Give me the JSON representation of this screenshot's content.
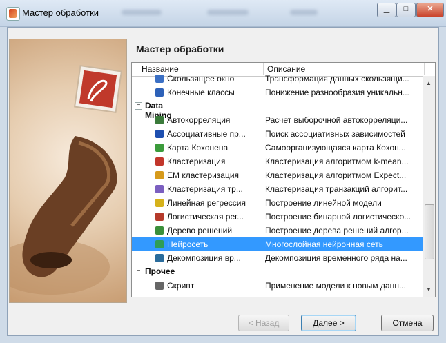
{
  "window": {
    "title": "Мастер обработки"
  },
  "wizard": {
    "heading": "Мастер обработки"
  },
  "list": {
    "columns": [
      "Название",
      "Описание"
    ],
    "rows": [
      {
        "kind": "item",
        "name": "Скользящее окно",
        "desc": "Трансформация данных скользящи...",
        "icon": "window-icon",
        "color": "#3a6fc4"
      },
      {
        "kind": "item",
        "name": "Конечные классы",
        "desc": "Понижение разнообразия уникальн...",
        "icon": "classes-icon",
        "color": "#2d61b8"
      },
      {
        "kind": "category",
        "name": "Data Mining",
        "toggle": "−"
      },
      {
        "kind": "item",
        "name": "Автокорреляция",
        "desc": "Расчет выборочной автокорреляци...",
        "icon": "autocorrelation-icon",
        "color": "#3a7a3a"
      },
      {
        "kind": "item",
        "name": "Ассоциативные пр...",
        "desc": "Поиск ассоциативных зависимостей",
        "icon": "association-icon",
        "color": "#1e4fb0"
      },
      {
        "kind": "item",
        "name": "Карта Кохонена",
        "desc": "Самоорганизующаяся карта Кохон...",
        "icon": "kohonen-map-icon",
        "color": "#3b9b3b"
      },
      {
        "kind": "item",
        "name": "Кластеризация",
        "desc": "Кластеризация алгоритмом k-mean...",
        "icon": "clustering-icon",
        "color": "#c2362b"
      },
      {
        "kind": "item",
        "name": "EM кластеризация",
        "desc": "Кластеризация алгоритмом Expect...",
        "icon": "em-clustering-icon",
        "color": "#d69a1b"
      },
      {
        "kind": "item",
        "name": "Кластеризация тр...",
        "desc": "Кластеризация транзакций алгорит...",
        "icon": "transaction-clustering-icon",
        "color": "#7b5fc0"
      },
      {
        "kind": "item",
        "name": "Линейная регрессия",
        "desc": "Построение линейной модели",
        "icon": "linear-regression-icon",
        "color": "#d6b21b"
      },
      {
        "kind": "item",
        "name": "Логистическая рег...",
        "desc": "Построение бинарной логистическо...",
        "icon": "logistic-regression-icon",
        "color": "#b53a2b"
      },
      {
        "kind": "item",
        "name": "Дерево решений",
        "desc": "Построение дерева решений алгор...",
        "icon": "decision-tree-icon",
        "color": "#3a8f3a"
      },
      {
        "kind": "item",
        "name": "Нейросеть",
        "desc": "Многослойная нейронная сеть",
        "icon": "neural-network-icon",
        "color": "#2f9d55",
        "selected": true
      },
      {
        "kind": "item",
        "name": "Декомпозиция вр...",
        "desc": "Декомпозиция временного ряда на...",
        "icon": "decomposition-icon",
        "color": "#2a6c9c"
      },
      {
        "kind": "category",
        "name": "Прочее",
        "toggle": "−"
      },
      {
        "kind": "item",
        "name": "Скрипт",
        "desc": "Применение модели к новым данн...",
        "icon": "script-icon",
        "color": "#666666"
      }
    ]
  },
  "buttons": {
    "back": "< Назад",
    "next": "Далее >",
    "cancel": "Отмена"
  }
}
